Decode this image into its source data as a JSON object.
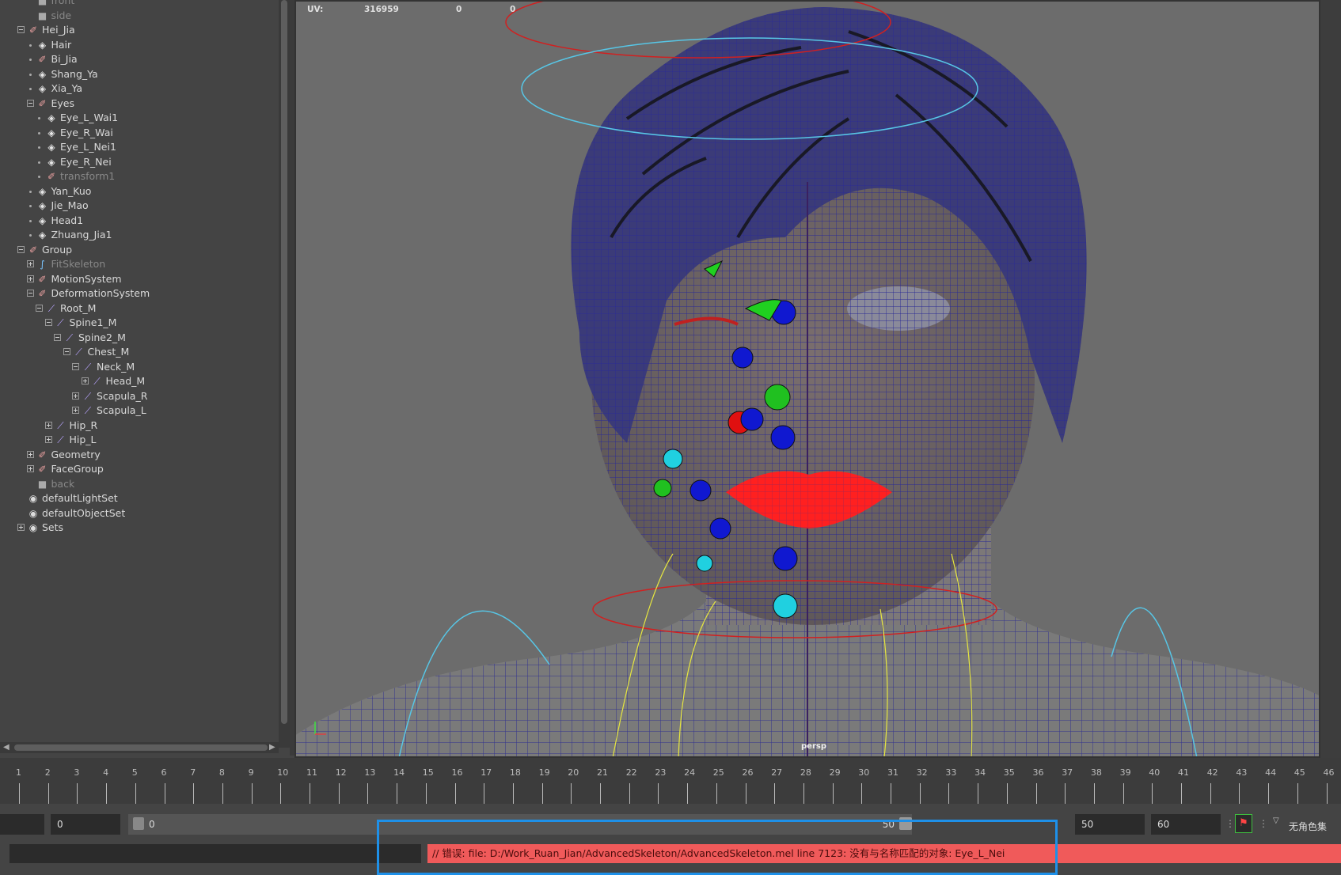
{
  "outliner": {
    "items": [
      {
        "label": "front",
        "icon": "camera-icon",
        "dim": true
      },
      {
        "label": "side",
        "icon": "camera-icon",
        "dim": true
      },
      {
        "label": "Hei_Jia",
        "icon": "transform-icon"
      },
      {
        "label": "Hair",
        "icon": "mesh-icon"
      },
      {
        "label": "Bi_Jia",
        "icon": "transform-icon"
      },
      {
        "label": "Shang_Ya",
        "icon": "mesh-icon"
      },
      {
        "label": "Xia_Ya",
        "icon": "mesh-icon"
      },
      {
        "label": "Eyes",
        "icon": "transform-icon"
      },
      {
        "label": "Eye_L_Wai1",
        "icon": "mesh-icon"
      },
      {
        "label": "Eye_R_Wai",
        "icon": "mesh-icon"
      },
      {
        "label": "Eye_L_Nei1",
        "icon": "mesh-icon"
      },
      {
        "label": "Eye_R_Nei",
        "icon": "mesh-icon"
      },
      {
        "label": "transform1",
        "icon": "transform-icon",
        "dim": true
      },
      {
        "label": "Yan_Kuo",
        "icon": "mesh-icon"
      },
      {
        "label": "Jie_Mao",
        "icon": "mesh-icon"
      },
      {
        "label": "Head1",
        "icon": "mesh-icon"
      },
      {
        "label": "Zhuang_Jia1",
        "icon": "mesh-icon"
      },
      {
        "label": "Group",
        "icon": "transform-icon"
      },
      {
        "label": "FitSkeleton",
        "icon": "curve-icon",
        "dim": true
      },
      {
        "label": "MotionSystem",
        "icon": "transform-icon"
      },
      {
        "label": "DeformationSystem",
        "icon": "transform-icon"
      },
      {
        "label": "Root_M",
        "icon": "joint-icon"
      },
      {
        "label": "Spine1_M",
        "icon": "joint-icon"
      },
      {
        "label": "Spine2_M",
        "icon": "joint-icon"
      },
      {
        "label": "Chest_M",
        "icon": "joint-icon"
      },
      {
        "label": "Neck_M",
        "icon": "joint-icon"
      },
      {
        "label": "Head_M",
        "icon": "joint-icon"
      },
      {
        "label": "Scapula_R",
        "icon": "joint-icon"
      },
      {
        "label": "Scapula_L",
        "icon": "joint-icon"
      },
      {
        "label": "Hip_R",
        "icon": "joint-icon"
      },
      {
        "label": "Hip_L",
        "icon": "joint-icon"
      },
      {
        "label": "Geometry",
        "icon": "transform-icon"
      },
      {
        "label": "FaceGroup",
        "icon": "transform-icon"
      },
      {
        "label": "back",
        "icon": "camera-icon",
        "dim": true
      },
      {
        "label": "defaultLightSet",
        "icon": "set-icon"
      },
      {
        "label": "defaultObjectSet",
        "icon": "set-icon"
      },
      {
        "label": "Sets",
        "icon": "set-icon"
      }
    ]
  },
  "viewport": {
    "hud_uv_label": "UV:",
    "hud_uv_value": "316959",
    "hud_uv_v2": "0",
    "hud_uv_v3": "0",
    "camera_label": "persp"
  },
  "timeline": {
    "frames": [
      "1",
      "2",
      "3",
      "4",
      "5",
      "6",
      "7",
      "8",
      "9",
      "10",
      "11",
      "12",
      "13",
      "14",
      "15",
      "16",
      "17",
      "18",
      "19",
      "20",
      "21",
      "22",
      "23",
      "24",
      "25",
      "26",
      "27",
      "28",
      "29",
      "30",
      "31",
      "32",
      "33",
      "34",
      "35",
      "36",
      "37",
      "38",
      "39",
      "40",
      "41",
      "42",
      "43",
      "44",
      "45",
      "46"
    ]
  },
  "range": {
    "start_field": "0",
    "slider_start": "0",
    "slider_end": "50",
    "end_field": "50",
    "anim_end_field": "60",
    "character_set": "无角色集"
  },
  "command_line": {
    "error_text": "// 错误: file: D:/Work_Ruan_Jian/AdvancedSkeleton/AdvancedSkeleton.mel line 7123: 没有与名称匹配的对象: Eye_L_Nei"
  },
  "colors": {
    "error_bg": "#f05a5a",
    "highlight": "#1e90e8",
    "wire": "#1f1f8f"
  }
}
